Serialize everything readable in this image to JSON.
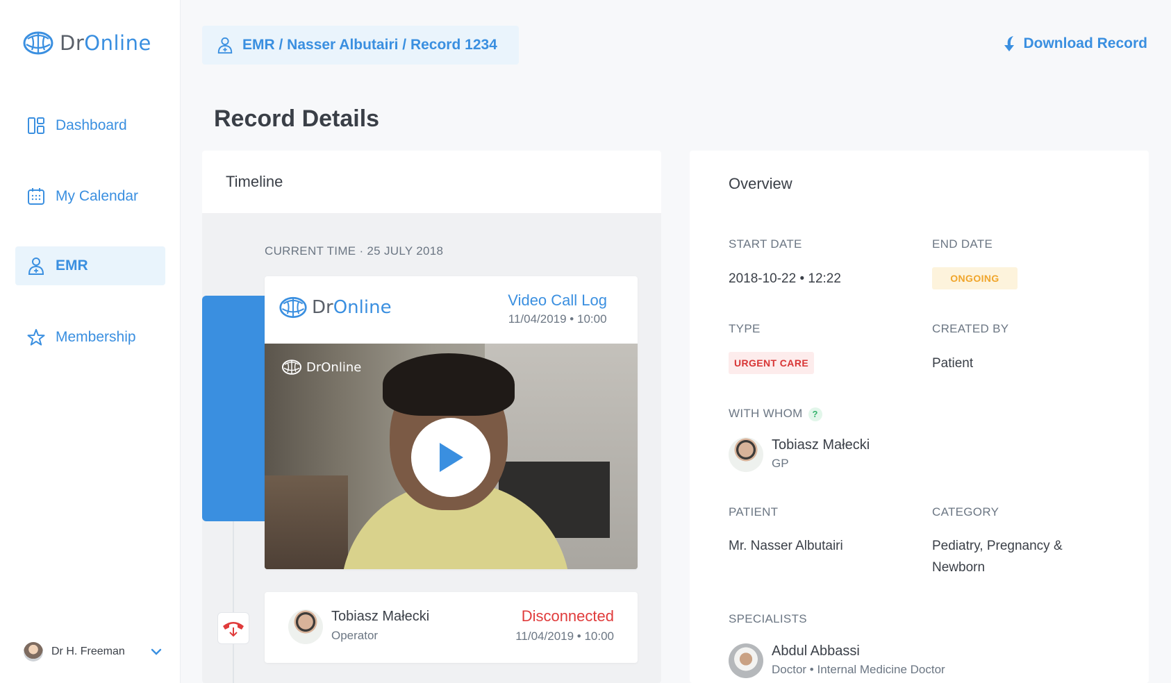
{
  "app": {
    "brand_dr": "Dr",
    "brand_online": "Online"
  },
  "sidebar": {
    "items": [
      {
        "label": "Dashboard",
        "icon": "dashboard-icon"
      },
      {
        "label": "My Calendar",
        "icon": "calendar-icon"
      },
      {
        "label": "EMR",
        "icon": "user-plus-icon",
        "active": true
      },
      {
        "label": "Membership",
        "icon": "star-icon"
      }
    ],
    "user": {
      "name": "Dr H. Freeman"
    }
  },
  "header": {
    "breadcrumb": "EMR / Nasser Albutairi / Record 1234",
    "download_label": "Download Record"
  },
  "page": {
    "title": "Record Details"
  },
  "timeline": {
    "title": "Timeline",
    "current_time": "CURRENT TIME · 25 JULY 2018",
    "video_log": {
      "title": "Video Call Log",
      "datetime": "11/04/2019 • 10:00"
    },
    "call": {
      "name": "Tobiasz Małecki",
      "role": "Operator",
      "status": "Disconnected",
      "datetime": "11/04/2019 • 10:00"
    }
  },
  "overview": {
    "title": "Overview",
    "start_date_label": "START DATE",
    "start_date": "2018-10-22 • 12:22",
    "end_date_label": "END DATE",
    "end_date_badge": "ONGOING",
    "type_label": "TYPE",
    "type_badge": "URGENT CARE",
    "created_by_label": "CREATED BY",
    "created_by": "Patient",
    "with_whom_label": "WITH WHOM",
    "with_whom": {
      "name": "Tobiasz Małecki",
      "role": "GP"
    },
    "patient_label": "PATIENT",
    "patient": "Mr. Nasser Albutairi",
    "category_label": "CATEGORY",
    "category_line1": "Pediatry, Pregnancy &",
    "category_line2": "Newborn",
    "specialists_label": "SPECIALISTS",
    "specialist": {
      "name": "Abdul Abbassi",
      "role": "Doctor • Internal Medicine Doctor"
    }
  },
  "colors": {
    "accent": "#3a8fe0",
    "danger": "#e03b3b",
    "warning": "#f0a52b",
    "success": "#34b36c"
  }
}
